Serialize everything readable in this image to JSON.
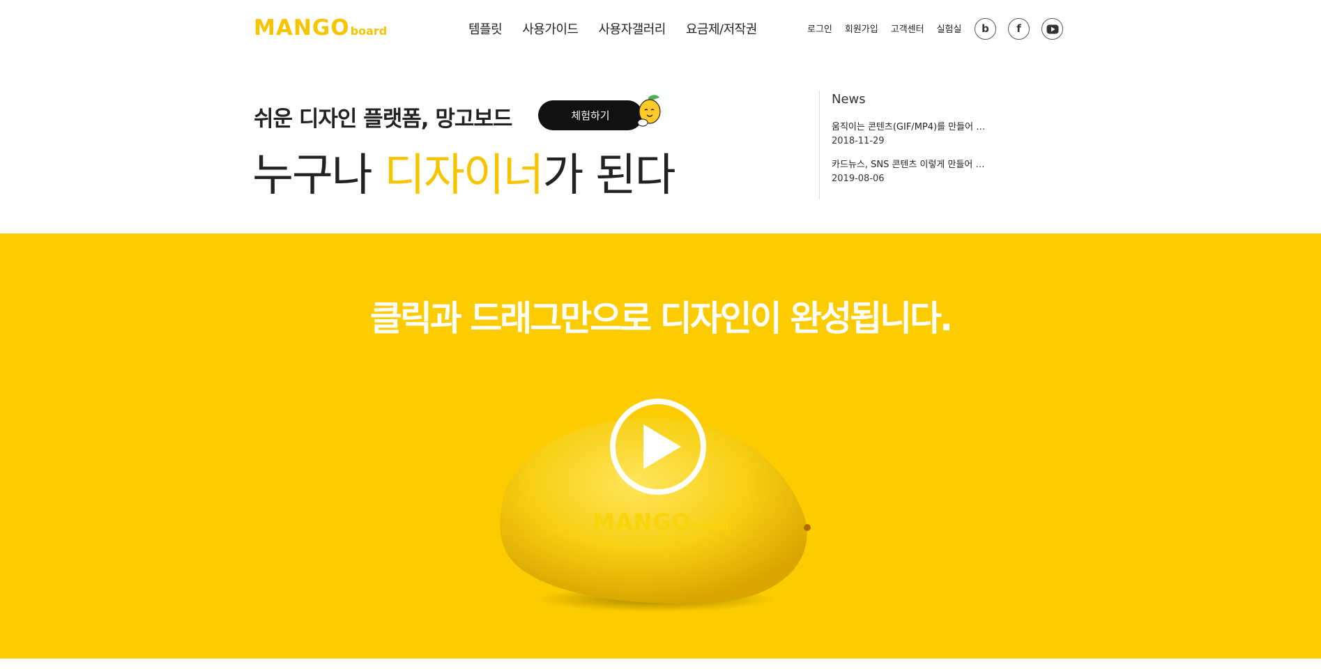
{
  "brand": {
    "logo_main": "MANGO",
    "logo_sub": "board",
    "accent_color": "#f7c400",
    "banner_color": "#fccb00"
  },
  "main_nav": [
    {
      "label": "템플릿"
    },
    {
      "label": "사용가이드"
    },
    {
      "label": "사용자갤러리"
    },
    {
      "label": "요금제/저작권"
    }
  ],
  "util_nav": [
    {
      "label": "로그인"
    },
    {
      "label": "회원가입"
    },
    {
      "label": "고객센터"
    },
    {
      "label": "실험실"
    }
  ],
  "social": [
    {
      "icon": "blog-icon",
      "glyph": "b"
    },
    {
      "icon": "facebook-icon",
      "glyph": "f"
    },
    {
      "icon": "youtube-icon",
      "glyph": "▶"
    }
  ],
  "hero": {
    "tagline": "쉬운 디자인 플랫폼, 망고보드",
    "trial_button": "체험하기",
    "headline_before": "누구나 ",
    "headline_accent": "디자이너",
    "headline_after": "가 된다"
  },
  "news": {
    "title": "News",
    "items": [
      {
        "text": "움직이는 콘텐츠(GIF/MP4)를 만들어 보...",
        "date": "2018-11-29"
      },
      {
        "text": "카드뉴스, SNS 콘텐츠 이렇게 만들어 보...",
        "date": "2019-08-06"
      }
    ]
  },
  "banner": {
    "title": "클릭과 드래그만으로 디자인이 완성됩니다.",
    "video_logo_main": "MANGO",
    "video_logo_sub": "board"
  }
}
